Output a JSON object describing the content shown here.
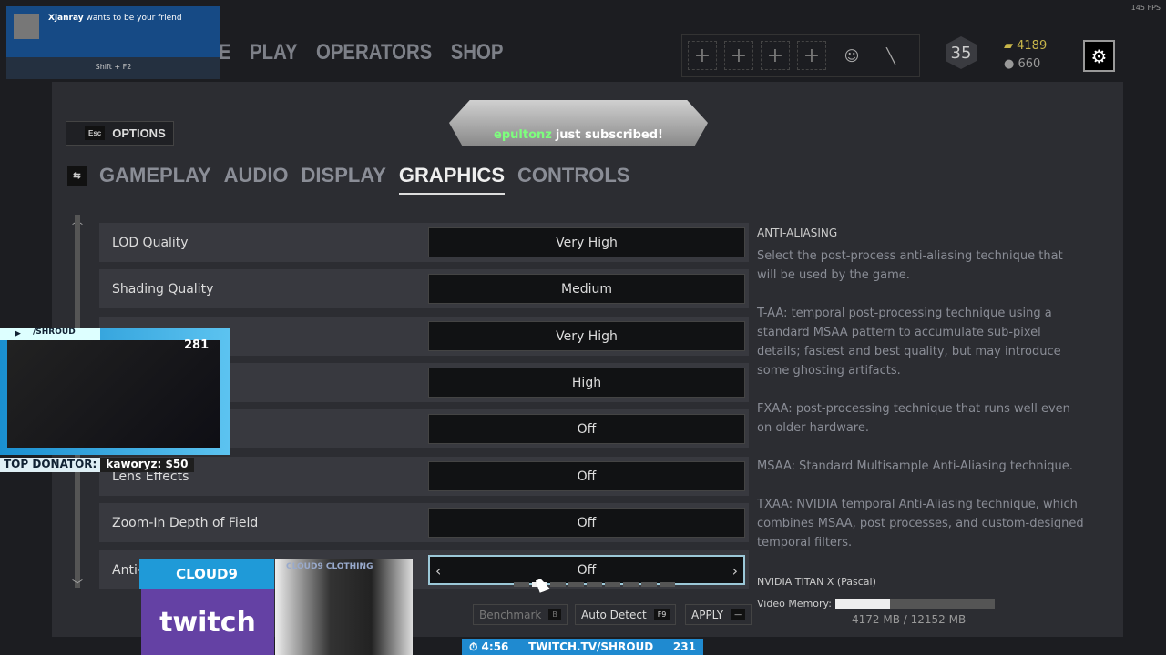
{
  "fps": "145 FPS",
  "nav": {
    "items": [
      "E",
      "PLAY",
      "OPERATORS",
      "SHOP"
    ]
  },
  "hud": {
    "level": "35",
    "renown": "4189",
    "credits": "660"
  },
  "notification": {
    "user": "Xjanray",
    "text": "wants to be your friend",
    "shortcut": "Shift + F2"
  },
  "options": {
    "esc": "Esc",
    "title": "OPTIONS"
  },
  "tabs": [
    "GAMEPLAY",
    "AUDIO",
    "DISPLAY",
    "GRAPHICS",
    "CONTROLS"
  ],
  "active_tab": "GRAPHICS",
  "alert": {
    "user": "epultonz",
    "text": "just subscribed!"
  },
  "settings": [
    {
      "label": "LOD Quality",
      "value": "Very High"
    },
    {
      "label": "Shading Quality",
      "value": "Medium"
    },
    {
      "label": "",
      "value": "Very High"
    },
    {
      "label": "",
      "value": "High"
    },
    {
      "label": "",
      "value": "Off"
    },
    {
      "label": "Lens Effects",
      "value": "Off"
    },
    {
      "label": "Zoom-In Depth of Field",
      "value": "Off"
    },
    {
      "label": "Anti-",
      "value": "Off"
    }
  ],
  "selected_option_index": 1,
  "option_count": 9,
  "description": {
    "title": "ANTI-ALIASING",
    "paragraphs": [
      "Select the post-process anti-aliasing technique that will be used by the game.",
      "T-AA: temporal post-processing technique using a standard MSAA pattern to accumulate sub-pixel details; fastest and best quality, but may introduce some ghosting artifacts.",
      "FXAA: post-processing technique that runs well even on older hardware.",
      "MSAA: Standard Multisample Anti-Aliasing technique.",
      "TXAA: NVIDIA temporal Anti-Aliasing technique, which combines MSAA, post processes, and custom-designed temporal filters."
    ]
  },
  "gpu": {
    "name": "NVIDIA TITAN X (Pascal)",
    "memory_label": "Video Memory:",
    "used_mb": 4172,
    "total_mb": 12152,
    "memory_text": "4172 MB / 12152 MB"
  },
  "buttons": {
    "benchmark": "Benchmark",
    "benchmark_key": "B",
    "auto_detect": "Auto Detect",
    "auto_key": "F9",
    "apply": "APPLY",
    "apply_key": "—"
  },
  "stream": {
    "channel": "/SHROUD",
    "viewers": "281",
    "donor_label": "TOP DONATOR:",
    "donor": "kaworyz: $50",
    "cloud9": "CLOUD9",
    "twitch": "twitch",
    "clothing": "CLOUD9 CLOTHING",
    "timer": "4:56",
    "url": "TWITCH.TV/SHROUD",
    "subs": "231"
  }
}
